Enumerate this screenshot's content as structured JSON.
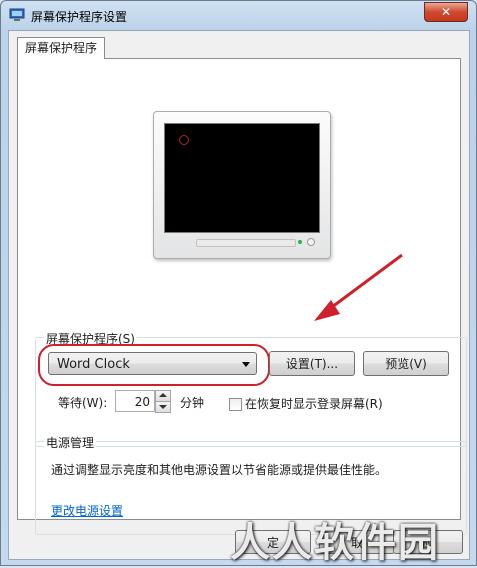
{
  "window": {
    "title": "屏幕保护程序设置",
    "close_glyph": "✕"
  },
  "tab": {
    "label": "屏幕保护程序"
  },
  "screensaver": {
    "group_label": "屏幕保护程序(S)",
    "selected": "Word Clock",
    "settings_button": "设置(T)...",
    "preview_button": "预览(V)",
    "wait_label": "等待(W):",
    "wait_value": "20",
    "minutes_label": "分钟",
    "resume_checkbox_label": "在恢复时显示登录屏幕(R)",
    "resume_checked": false
  },
  "power": {
    "group_label": "电源管理",
    "description": "通过调整显示亮度和其他电源设置以节省能源或提供最佳性能。",
    "link_text": "更改电源设置"
  },
  "footer": {
    "ok_partial": "定",
    "cancel_partial": "取",
    "apply_partial": "应"
  },
  "watermark": {
    "text": "人人软件园"
  },
  "colors": {
    "annotation_red": "#d0202c",
    "link_blue": "#0066cc",
    "close_red": "#c4381f"
  }
}
